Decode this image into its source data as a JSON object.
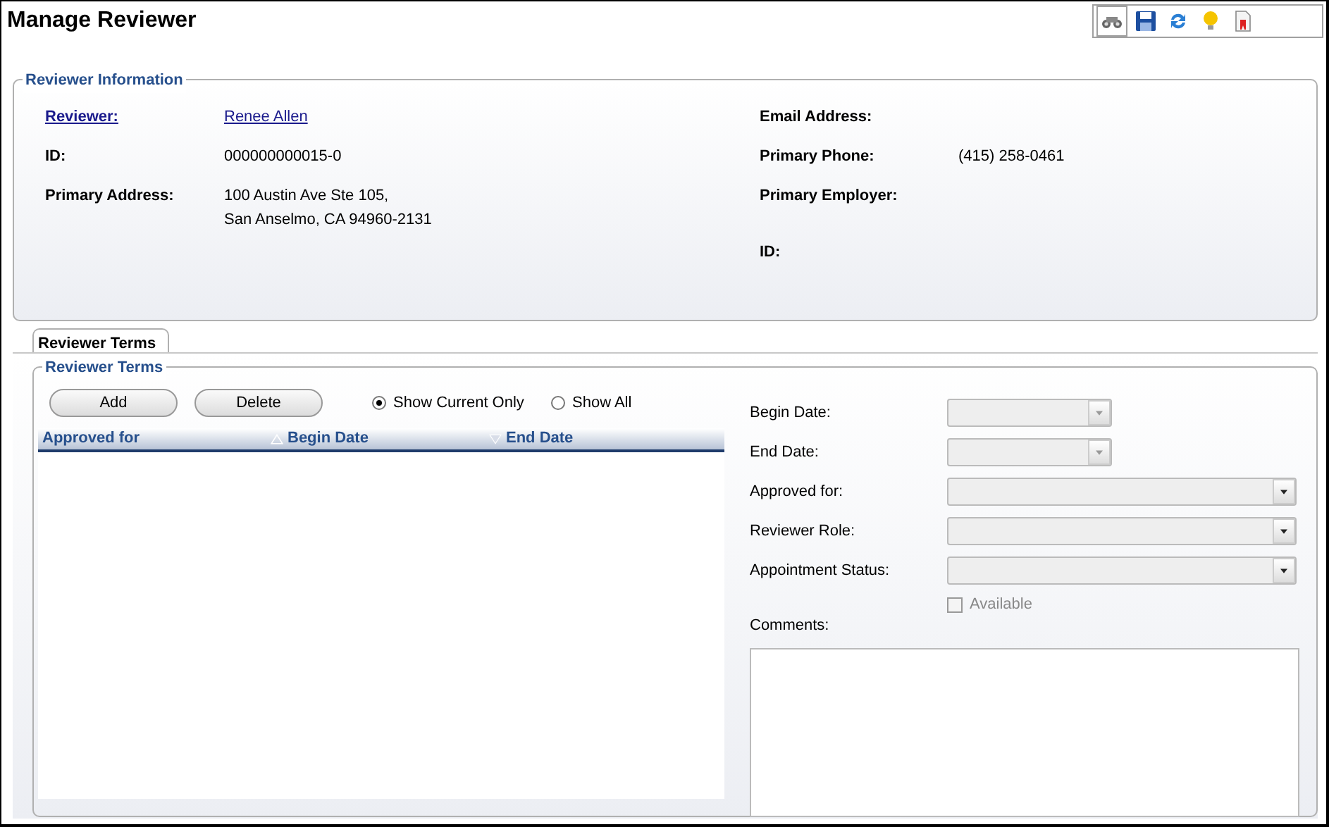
{
  "title": "Manage Reviewer",
  "toolbar": [
    {
      "kind": "binoculars",
      "selected": true
    },
    {
      "kind": "save",
      "selected": false
    },
    {
      "kind": "refresh",
      "selected": false
    },
    {
      "kind": "bulb",
      "selected": false
    },
    {
      "kind": "report",
      "selected": false
    }
  ],
  "info": {
    "legend": "Reviewer Information",
    "left": [
      {
        "label": "Reviewer:",
        "value": "Renee Allen",
        "link": true
      },
      {
        "label": "ID:",
        "value": "000000000015-0",
        "link": false
      },
      {
        "label": "Primary Address:",
        "value": "100 Austin Ave Ste 105,\nSan Anselmo, CA 94960-2131",
        "link": false
      }
    ],
    "right": [
      {
        "label": "Email Address:"
      },
      {
        "label": "Primary Phone:",
        "value": "(415) 258-0461"
      },
      {
        "label": "Primary Employer:"
      },
      {
        "label": "ID:"
      }
    ]
  },
  "tabs": [
    {
      "label": "Reviewer Terms",
      "selected": true
    }
  ],
  "terms": {
    "legend": "Reviewer Terms",
    "buttons": [
      "Add",
      "Delete"
    ],
    "filters": [
      {
        "label": "Show Current Only",
        "selected": true
      },
      {
        "label": "Show All",
        "selected": false
      }
    ],
    "columns": [
      {
        "label": "Approved for",
        "kind": "plain"
      },
      {
        "label": "Begin Date",
        "kind": "ascending"
      },
      {
        "label": "End Date",
        "kind": "descending"
      }
    ],
    "fields": [
      {
        "label": "Begin Date:",
        "kind": "date"
      },
      {
        "label": "End Date:",
        "kind": "date"
      },
      {
        "label": "Approved for:",
        "kind": "select"
      },
      {
        "label": "Reviewer Role:",
        "kind": "select"
      },
      {
        "label": "Appointment Status:",
        "kind": "select"
      }
    ],
    "checkbox": {
      "label": "Available",
      "checked": false
    },
    "comments": {
      "label": "Comments:"
    }
  }
}
